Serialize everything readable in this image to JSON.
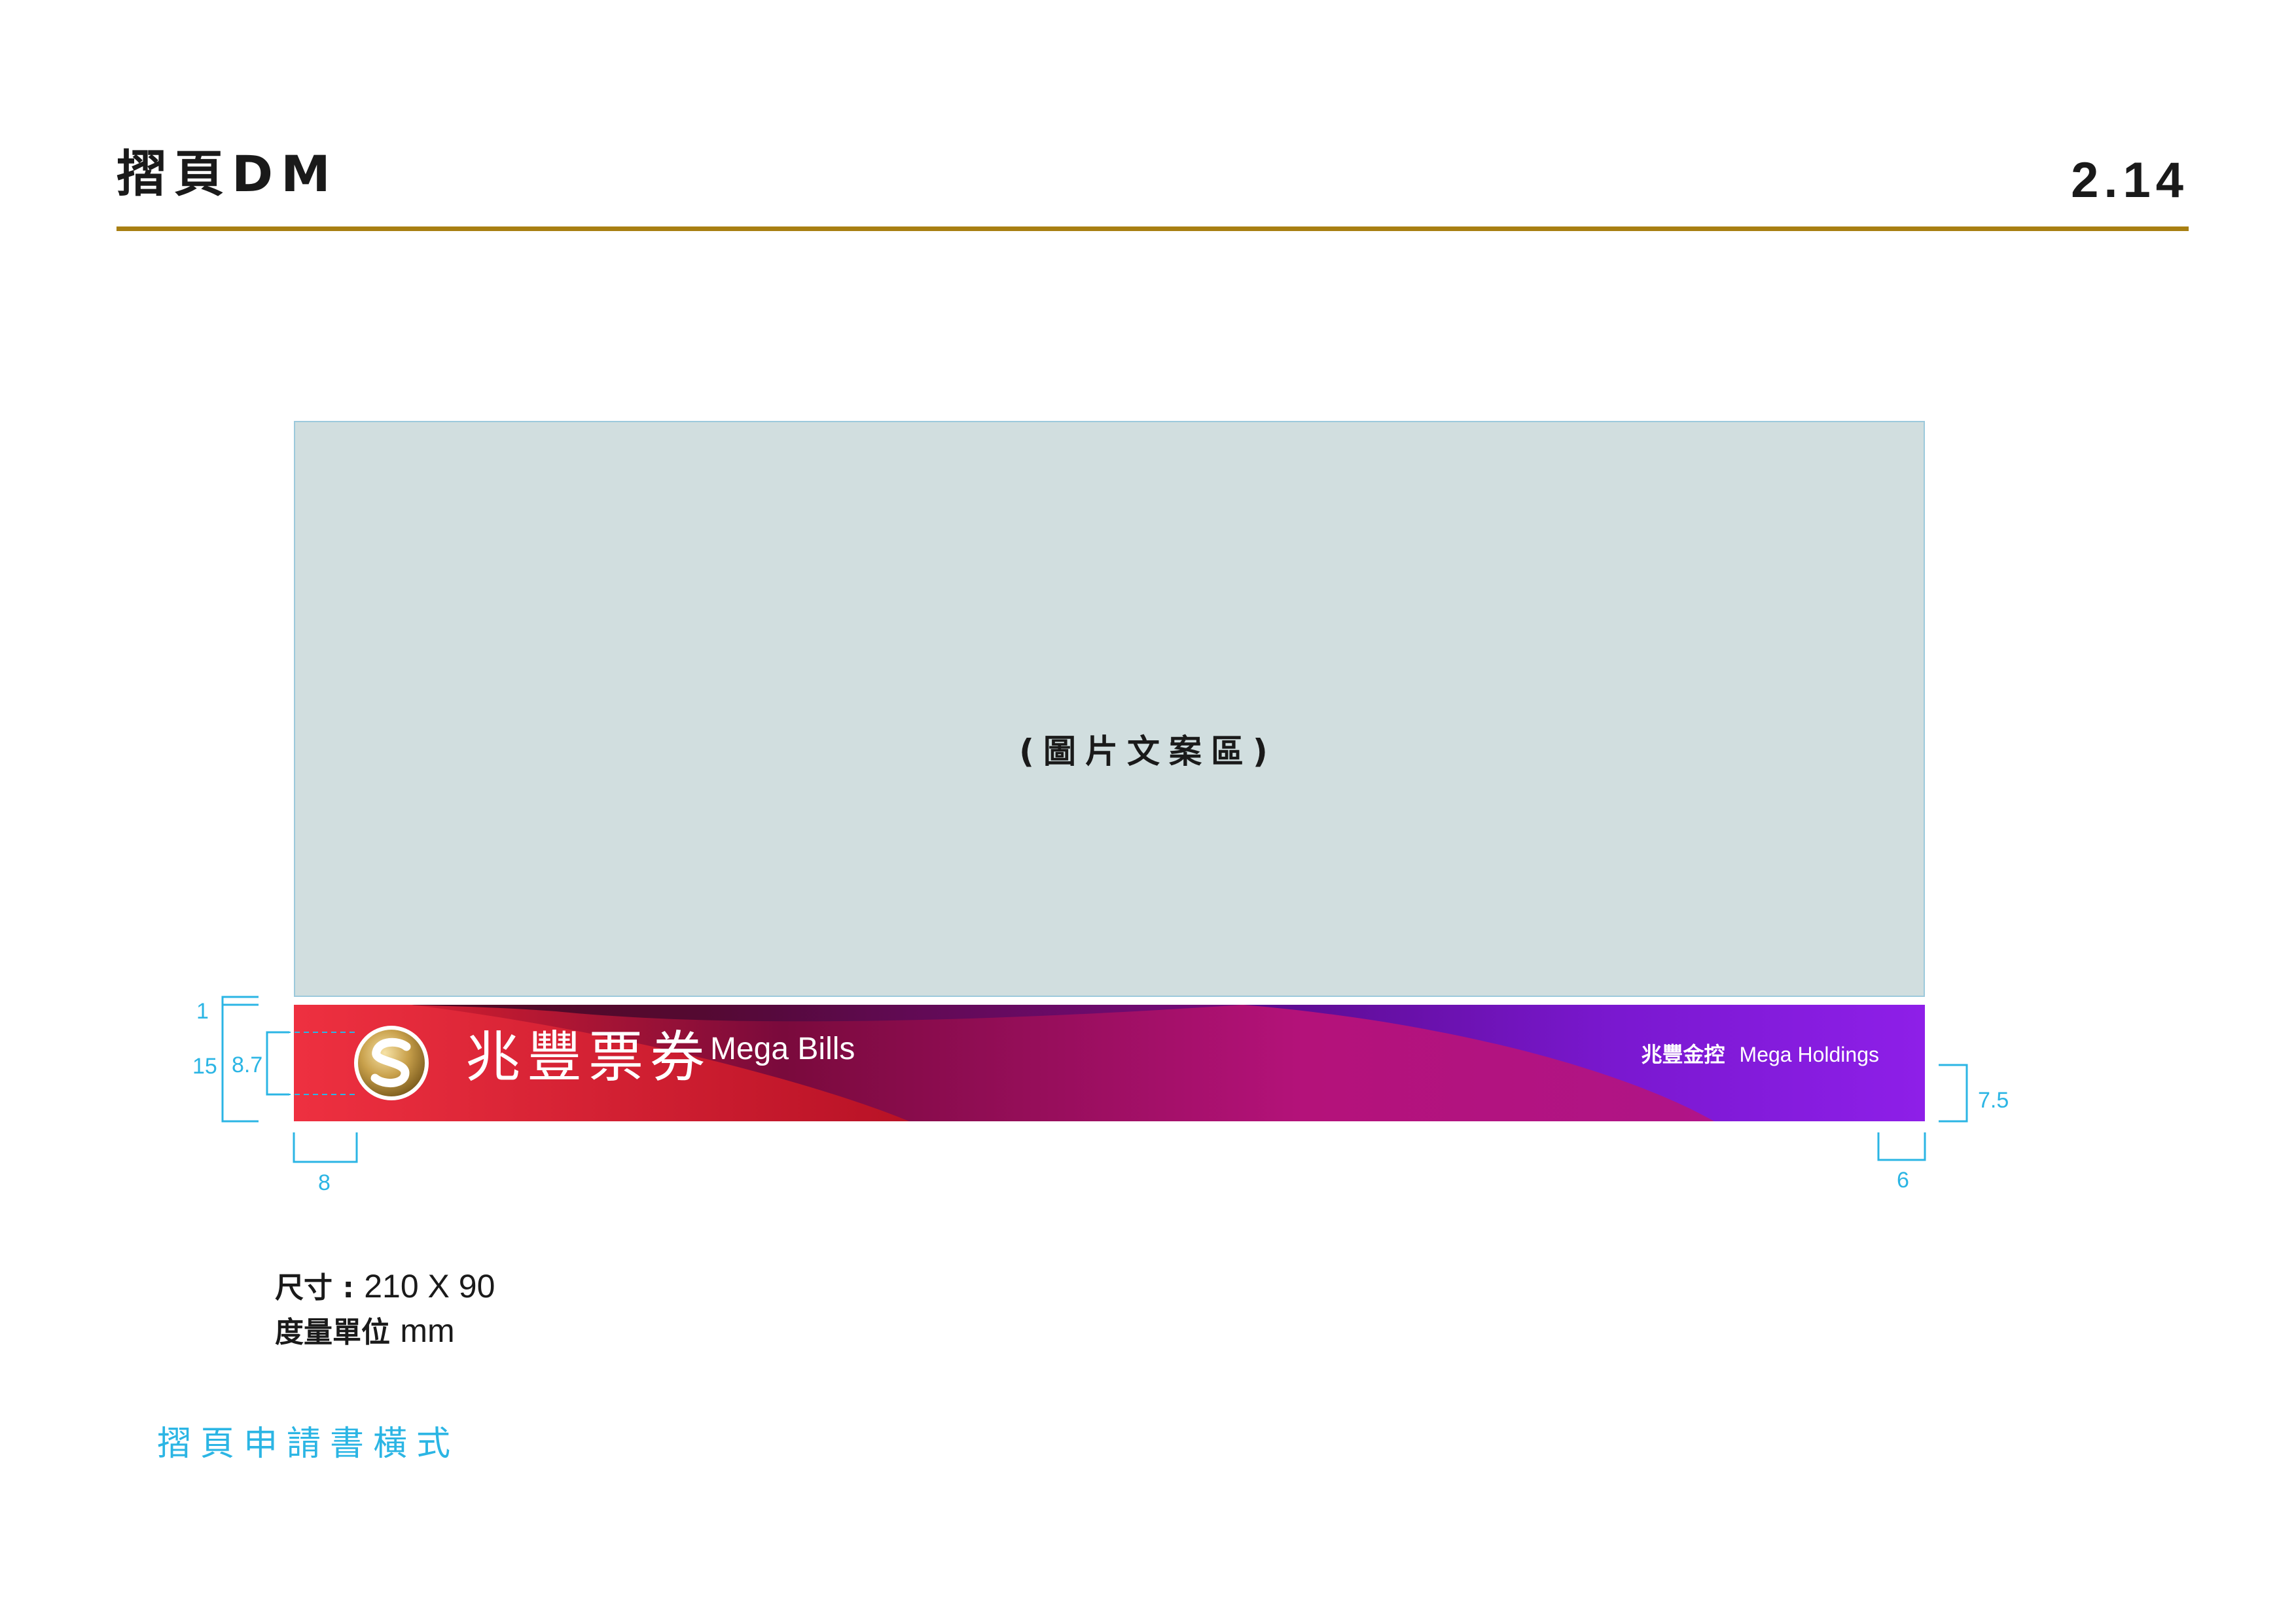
{
  "header": {
    "title": "摺頁DM",
    "page_number": "2.14",
    "rule_color": "#a87f12"
  },
  "image_area": {
    "label": "(圖片文案區)",
    "fill_color": "#d1dedf"
  },
  "brand_bar": {
    "logo_icon": "mega-logo-icon",
    "name_zh": "兆豐票券",
    "name_en": "Mega Bills",
    "holdings_zh": "兆豐金控",
    "holdings_en": "Mega Holdings",
    "colors": {
      "red": "#e8293a",
      "maroon": "#7a0a3c",
      "magenta": "#b4127a",
      "purple": "#8e1fe8"
    }
  },
  "dimensions": {
    "color": "#2bb5e4",
    "gap": "1",
    "bar_height": "15",
    "logo_height": "8.7",
    "left_margin": "8",
    "right_margin": "6",
    "text_offset": "7.5"
  },
  "spec": {
    "size_key": "尺寸 : ",
    "size_value": "210 X 90",
    "unit_key": "度量單位 ",
    "unit_value": "mm"
  },
  "footnote": "摺頁申請書橫式"
}
